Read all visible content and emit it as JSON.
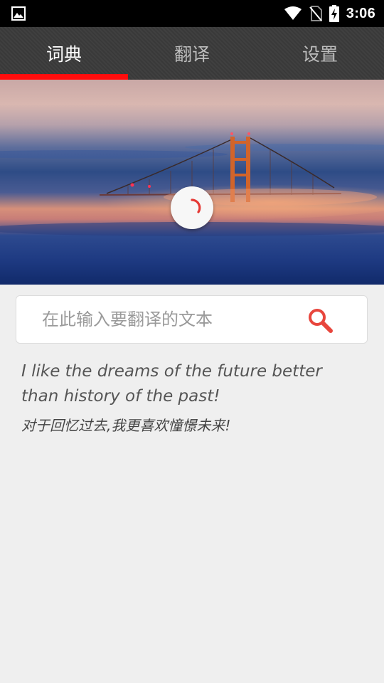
{
  "status_bar": {
    "time": "3:06",
    "icons": [
      "gallery-icon",
      "wifi-icon",
      "no-sim-icon",
      "battery-charging-icon"
    ]
  },
  "tabs": [
    {
      "label": "词典",
      "active": true
    },
    {
      "label": "翻译",
      "active": false
    },
    {
      "label": "设置",
      "active": false
    }
  ],
  "colors": {
    "accent": "#ff0d0d",
    "tab_bar": "#3b3b3b",
    "search_icon": "#e8463d"
  },
  "search": {
    "placeholder": "在此输入要翻译的文本",
    "value": ""
  },
  "quote": {
    "english": "I like the dreams of the future better than history of the past!",
    "chinese": "对于回忆过去,我更喜欢憧憬未来!"
  }
}
